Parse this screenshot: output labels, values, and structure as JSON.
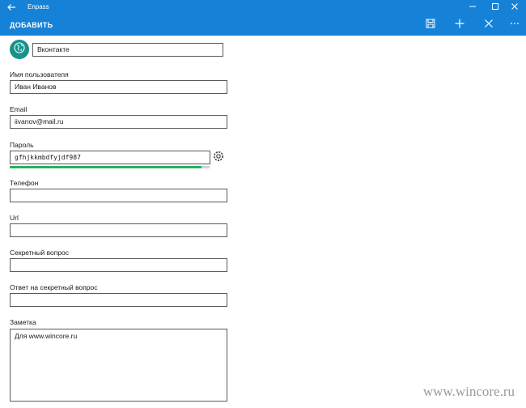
{
  "window": {
    "title": "Enpass",
    "controls": [
      "minimize-icon",
      "maximize-icon",
      "close-icon"
    ]
  },
  "appbar": {
    "heading": "ДОБАВИТЬ",
    "actions": [
      "save-icon",
      "add-icon",
      "cancel-icon",
      "more-icon"
    ]
  },
  "item": {
    "icon": "globe-icon",
    "title": "Вконтакте"
  },
  "fields": {
    "username": {
      "label": "Имя пользователя",
      "value": "Иван Иванов"
    },
    "email": {
      "label": "Email",
      "value": "iivanov@mail.ru"
    },
    "password": {
      "label": "Пароль",
      "value": "gfhjkkmbdfyjdf987",
      "strength": 0.96
    },
    "phone": {
      "label": "Телефон",
      "value": ""
    },
    "url": {
      "label": "Url",
      "value": ""
    },
    "secret_question": {
      "label": "Секретный вопрос",
      "value": ""
    },
    "secret_answer": {
      "label": "Ответ на секретный вопрос",
      "value": ""
    },
    "note": {
      "label": "Заметка",
      "value": "Для www.wincore.ru"
    }
  },
  "watermark": "www.wincore.ru",
  "colors": {
    "accent": "#1582d8",
    "avatar": "#17938a",
    "strength": "#22b35e"
  }
}
